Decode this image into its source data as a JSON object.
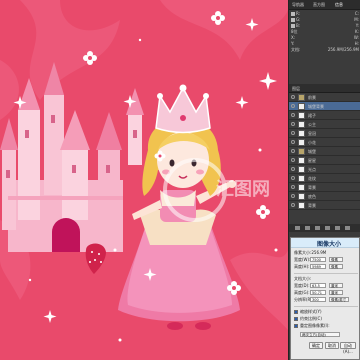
{
  "panel": {
    "tabs": [
      "导航器",
      "直方图",
      "信息"
    ],
    "info": {
      "rows": [
        [
          "R:",
          "",
          "C:",
          ""
        ],
        [
          "G:",
          "",
          "M:",
          ""
        ],
        [
          "B:",
          "",
          "Y:",
          ""
        ],
        [
          "8位",
          "",
          "K:",
          ""
        ],
        [
          "X:",
          "",
          "W:",
          ""
        ],
        [
          "Y:",
          "",
          "H:",
          ""
        ]
      ],
      "doc_label": "文档:",
      "doc_value": "256.9M/256.9M"
    },
    "layers": {
      "header": "图层",
      "items": [
        {
          "name": "前景",
          "selected": false,
          "group": true
        },
        {
          "name": "城堡背景",
          "selected": true,
          "group": false
        },
        {
          "name": "裙子",
          "selected": false,
          "group": false
        },
        {
          "name": "公主",
          "selected": false,
          "group": false
        },
        {
          "name": "皇冠",
          "selected": false,
          "group": false
        },
        {
          "name": "小花",
          "selected": false,
          "group": false
        },
        {
          "name": "城堡",
          "selected": false,
          "group": true
        },
        {
          "name": "星星",
          "selected": false,
          "group": false
        },
        {
          "name": "光点",
          "selected": false,
          "group": false
        },
        {
          "name": "花纹",
          "selected": false,
          "group": false
        },
        {
          "name": "背景",
          "selected": false,
          "group": false
        },
        {
          "name": "底色",
          "selected": false,
          "group": false
        },
        {
          "name": "背景",
          "selected": false,
          "group": false
        }
      ]
    }
  },
  "dialog": {
    "title": "图像大小",
    "pixel_dims_label": "像素大小:",
    "pixel_dims_value": "256.9M",
    "width_label": "宽度(W):",
    "width_value": "7500",
    "width_unit": "像素",
    "height_label": "高度(H):",
    "height_value": "5989",
    "height_unit": "像素",
    "doc_size_label": "文档大小:",
    "doc_width_label": "宽度(D):",
    "doc_width_value": "63.5",
    "doc_width_unit": "厘米",
    "doc_height_label": "高度(G):",
    "doc_height_value": "50.71",
    "doc_height_unit": "厘米",
    "resolution_label": "分辨率(R):",
    "resolution_value": "300",
    "resolution_unit": "像素/英寸",
    "scale_styles_label": "缩放样式(Y)",
    "constrain_label": "约束比例(C)",
    "resample_label": "重定图像像素(I):",
    "resample_value": "两次立方(自动)",
    "ok_label": "确定",
    "cancel_label": "取消",
    "auto_label": "自动(A)..."
  },
  "canvas": {
    "watermark": "汇图网"
  }
}
